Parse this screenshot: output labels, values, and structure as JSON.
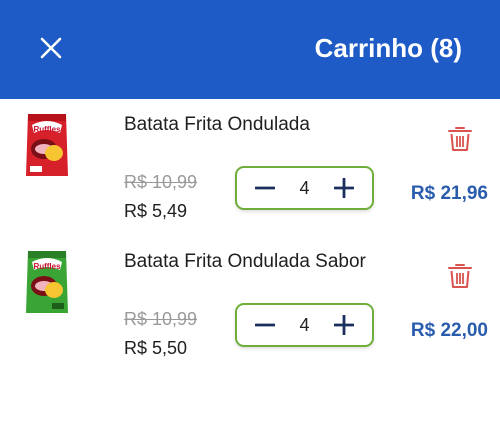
{
  "header": {
    "title": "Carrinho (8)",
    "close_icon": "close-icon",
    "bg_color": "#1e5bc6"
  },
  "items": [
    {
      "name": "Batata Frita Ondulada",
      "old_price": "R$ 10,99",
      "price": "R$ 5,49",
      "quantity": "4",
      "total": "R$ 21,96",
      "package_color": "#d6202a",
      "thumb_brand": "Ruffles"
    },
    {
      "name": "Batata Frita Ondulada Sabor",
      "old_price": "R$ 10,99",
      "price": "R$ 5,50",
      "quantity": "4",
      "total": "R$ 22,00",
      "package_color": "#3aa535",
      "thumb_brand": "Ruffles"
    }
  ],
  "colors": {
    "accent": "#1e5bc6",
    "total_text": "#2a5cae",
    "stepper_border": "#6fae3a",
    "trash": "#d9534f"
  }
}
